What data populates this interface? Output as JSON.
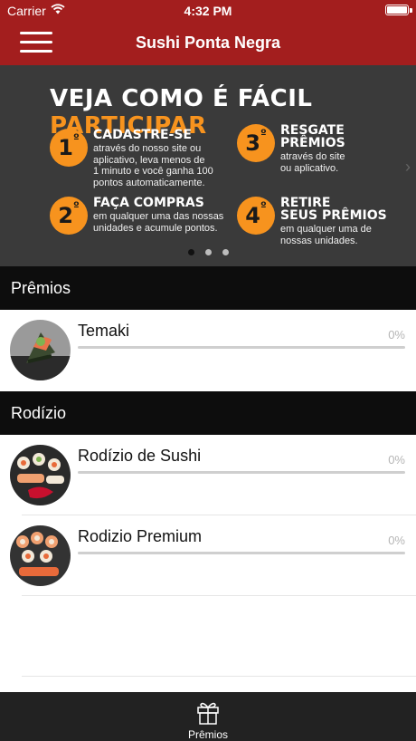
{
  "status_bar": {
    "carrier": "Carrier",
    "time": "4:32 PM"
  },
  "nav": {
    "title": "Sushi Ponta Negra"
  },
  "banner": {
    "headline_part1": "VEJA COMO É FÁCIL",
    "headline_part2": "PARTICIPAR",
    "steps": [
      {
        "number": "1",
        "ordinal": "º",
        "title": "CADASTRE-SE",
        "description": "através do nosso site ou\naplicativo, leva menos de\n1 minuto e você ganha 100\npontos automaticamente."
      },
      {
        "number": "3",
        "ordinal": "º",
        "title": "RESGATE\nPRÊMIOS",
        "description": "através do site\nou aplicativo."
      },
      {
        "number": "2",
        "ordinal": "º",
        "title": "FAÇA COMPRAS",
        "description": "em qualquer uma das nossas\nunidades e acumule pontos."
      },
      {
        "number": "4",
        "ordinal": "º",
        "title": "RETIRE\nSEUS PRÊMIOS",
        "description": "em qualquer uma de\nnossas unidades."
      }
    ],
    "accent_color": "#f7931e"
  },
  "sections": [
    {
      "title": "Prêmios",
      "items": [
        {
          "name": "Temaki",
          "progress_label": "0%",
          "progress": 0
        }
      ]
    },
    {
      "title": "Rodízio",
      "items": [
        {
          "name": "Rodízio de Sushi",
          "progress_label": "0%",
          "progress": 0
        },
        {
          "name": "Rodizio Premium",
          "progress_label": "0%",
          "progress": 0
        }
      ]
    }
  ],
  "tabbar": {
    "tabs": [
      {
        "label": "Prêmios",
        "icon": "gift-icon"
      }
    ]
  },
  "colors": {
    "brand": "#a31e1e",
    "section_header": "#0d0d0d",
    "tabbar": "#222222"
  }
}
